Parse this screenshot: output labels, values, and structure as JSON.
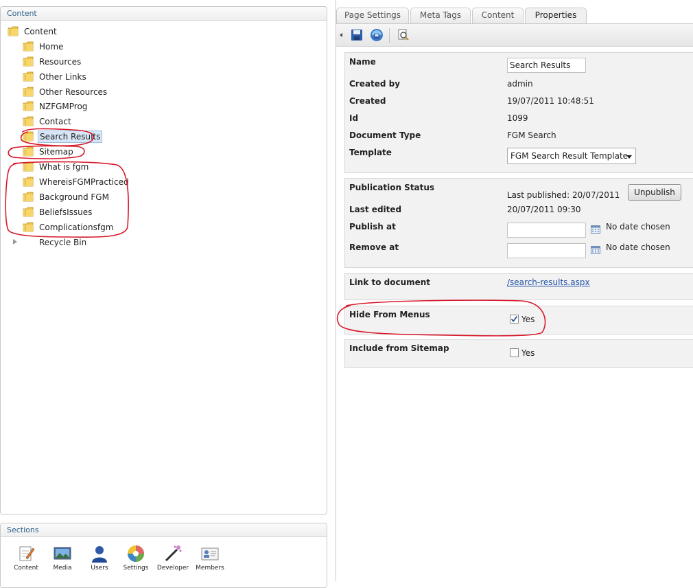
{
  "tree_panel": {
    "title": "Content",
    "root": "Content",
    "items": [
      {
        "label": "Home"
      },
      {
        "label": "Resources"
      },
      {
        "label": "Other Links"
      },
      {
        "label": "Other Resources"
      },
      {
        "label": "NZFGMProg"
      },
      {
        "label": "Contact"
      },
      {
        "label": "Search Results"
      },
      {
        "label": "Sitemap"
      },
      {
        "label": "What is fgm"
      },
      {
        "label": "WhereisFGMPracticed"
      },
      {
        "label": "Background FGM"
      },
      {
        "label": "BeliefsIssues"
      },
      {
        "label": "Complicationsfgm"
      }
    ],
    "recycle_bin": "Recycle Bin"
  },
  "sections_panel": {
    "title": "Sections",
    "items": [
      {
        "label": "Content",
        "icon": "pencil-document-icon"
      },
      {
        "label": "Media",
        "icon": "picture-icon"
      },
      {
        "label": "Users",
        "icon": "user-icon"
      },
      {
        "label": "Settings",
        "icon": "color-wheel-icon"
      },
      {
        "label": "Developer",
        "icon": "magic-wand-icon"
      },
      {
        "label": "Members",
        "icon": "member-cards-icon"
      }
    ]
  },
  "tabs": [
    "Page Settings",
    "Meta Tags",
    "Content",
    "Properties"
  ],
  "active_tab": "Properties",
  "properties": {
    "name_label": "Name",
    "name_value": "Search Results",
    "created_by_label": "Created by",
    "created_by_value": "admin",
    "created_label": "Created",
    "created_value": "19/07/2011 10:48:51",
    "id_label": "Id",
    "id_value": "1099",
    "doctype_label": "Document Type",
    "doctype_value": "FGM Search",
    "template_label": "Template",
    "template_value": "FGM Search Result Template"
  },
  "publication": {
    "status_label": "Publication Status",
    "last_published": "Last published: 20/07/2011",
    "unpublish_button": "Unpublish",
    "last_edited_label": "Last edited",
    "last_edited_value": "20/07/2011 09:30",
    "publish_at_label": "Publish at",
    "publish_at_value": "No date chosen",
    "remove_at_label": "Remove at",
    "remove_at_value": "No date chosen"
  },
  "link": {
    "label": "Link to document",
    "value": "/search-results.aspx"
  },
  "hide_from_menus": {
    "label": "Hide From Menus",
    "option": "Yes",
    "checked": true
  },
  "include_sitemap": {
    "label": "Include from Sitemap",
    "option": "Yes",
    "checked": false
  },
  "colors": {
    "annotation": "#d7192a",
    "panel_title": "#2a5f8c",
    "link": "#1e4fa5",
    "selection": "#d7e7f7"
  }
}
